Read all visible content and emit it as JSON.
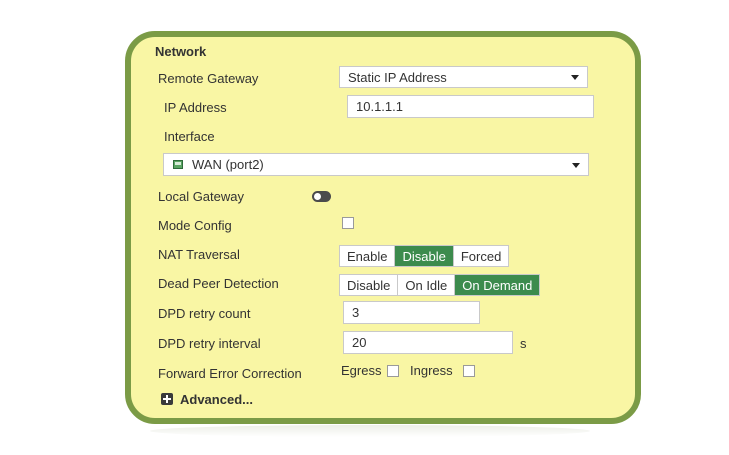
{
  "network": {
    "title": "Network",
    "remote_gateway": {
      "label": "Remote Gateway",
      "value": "Static IP Address"
    },
    "ip_address": {
      "label": "IP Address",
      "value": "10.1.1.1"
    },
    "interface": {
      "label": "Interface",
      "value": "WAN (port2)"
    },
    "local_gateway": {
      "label": "Local Gateway",
      "enabled": false
    },
    "mode_config": {
      "label": "Mode Config",
      "checked": false
    },
    "nat_traversal": {
      "label": "NAT Traversal",
      "options": [
        "Enable",
        "Disable",
        "Forced"
      ],
      "selected": "Disable"
    },
    "dead_peer_detection": {
      "label": "Dead Peer Detection",
      "options": [
        "Disable",
        "On Idle",
        "On Demand"
      ],
      "selected": "On Demand"
    },
    "dpd_retry_count": {
      "label": "DPD retry count",
      "value": "3"
    },
    "dpd_retry_interval": {
      "label": "DPD retry interval",
      "value": "20",
      "unit": "s"
    },
    "fec": {
      "label": "Forward Error Correction",
      "egress_label": "Egress",
      "ingress_label": "Ingress",
      "egress_checked": false,
      "ingress_checked": false
    },
    "advanced": {
      "label": "Advanced..."
    }
  },
  "colors": {
    "panel_bg": "#f9f6a4",
    "panel_border": "#7b9b46",
    "active_option": "#3c8b4d"
  }
}
